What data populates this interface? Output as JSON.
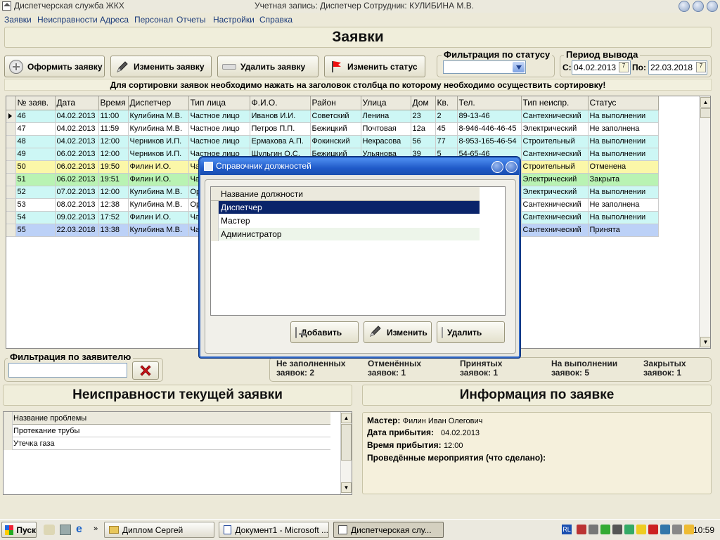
{
  "window": {
    "title": "Диспетчерская служба ЖКХ",
    "account": "Учетная запись:  Диспетчер   Сотрудник:  КУЛИБИНА М.В."
  },
  "menu": [
    "Заявки",
    "Неисправности",
    "Адреса",
    "Персонал",
    "Отчеты",
    "Настройки",
    "Справка"
  ],
  "page_title": "Заявки",
  "toolbar": {
    "create": "Оформить заявку",
    "edit": "Изменить заявку",
    "delete": "Удалить заявку",
    "status": "Изменить статус"
  },
  "status_filter": {
    "label": "Фильтрация по статусу",
    "value": ""
  },
  "period": {
    "label": "Период вывода",
    "from_label": "С:",
    "from": "04.02.2013",
    "to_label": "По:",
    "to": "22.03.2018"
  },
  "sort_note": "Для сортировки заявок необходимо нажать на заголовок столбца по которому необходимо осуществить сортировку!",
  "grid": {
    "columns": [
      "№ заяв.",
      "Дата",
      "Время",
      "Диспетчер",
      "Тип лица",
      "Ф.И.О.",
      "Район",
      "Улица",
      "Дом",
      "Кв.",
      "Тел.",
      "Тип неиспр.",
      "Статус"
    ],
    "rows": [
      {
        "cells": [
          "46",
          "04.02.2013",
          "11:00",
          "Кулибина М.В.",
          "Частное лицо",
          "Иванов И.И.",
          "Советский",
          "Ленина",
          "23",
          "2",
          "89-13-46",
          "Сантехнический",
          "На выполнении"
        ],
        "color": "#cdf7f5"
      },
      {
        "cells": [
          "47",
          "04.02.2013",
          "11:59",
          "Кулибина М.В.",
          "Частное лицо",
          "Петров П.П.",
          "Бежицкий",
          "Почтовая",
          "12а",
          "45",
          "8-946-446-46-45",
          "Электрический",
          "Не заполнена"
        ],
        "color": "#ffffff"
      },
      {
        "cells": [
          "48",
          "04.02.2013",
          "12:00",
          "Черников И.П.",
          "Частное лицо",
          "Ермакова А.П.",
          "Фокинский",
          "Некрасова",
          "56",
          "77",
          "8-953-165-46-54",
          "Строительный",
          "На выполнении"
        ],
        "color": "#cdf7f5"
      },
      {
        "cells": [
          "49",
          "06.02.2013",
          "12:00",
          "Черников И.П.",
          "Частное лицо",
          "Шульгин О.С.",
          "Бежицкий",
          "Ульянова",
          "39",
          "5",
          "54-65-46",
          "Сантехнический",
          "На выполнении"
        ],
        "color": "#cdf7f5"
      },
      {
        "cells": [
          "50",
          "06.02.2013",
          "19:50",
          "Филин И.О.",
          "Ча",
          "",
          "",
          "",
          "",
          "",
          "",
          "Строительный",
          "Отменена"
        ],
        "color": "#fbf7a8"
      },
      {
        "cells": [
          "51",
          "06.02.2013",
          "19:51",
          "Филин И.О.",
          "Ча",
          "",
          "",
          "",
          "",
          "",
          "",
          "Электрический",
          "Закрыта"
        ],
        "color": "#b9f3b3"
      },
      {
        "cells": [
          "52",
          "07.02.2013",
          "12:00",
          "Кулибина М.В.",
          "Ор",
          "",
          "",
          "",
          "",
          "",
          "",
          "Электрический",
          "На выполнении"
        ],
        "color": "#cdf7f5"
      },
      {
        "cells": [
          "53",
          "08.02.2013",
          "12:38",
          "Кулибина М.В.",
          "Ор",
          "",
          "",
          "",
          "",
          "",
          "",
          "Сантехнический",
          "Не заполнена"
        ],
        "color": "#ffffff"
      },
      {
        "cells": [
          "54",
          "09.02.2013",
          "17:52",
          "Филин И.О.",
          "Ча",
          "",
          "",
          "",
          "",
          "",
          "",
          "Сантехнический",
          "На выполнении"
        ],
        "color": "#cdf7f5"
      },
      {
        "cells": [
          "55",
          "22.03.2018",
          "13:38",
          "Кулибина М.В.",
          "Ча",
          "",
          "",
          "",
          "",
          "",
          "",
          "Сантехнический",
          "Принята"
        ],
        "color": "#bcd1f7"
      }
    ]
  },
  "applicant_filter": {
    "label": "Фильтрация по заявителю",
    "value": ""
  },
  "stats": [
    {
      "line1": "Не заполненных",
      "line2": "заявок: 2"
    },
    {
      "line1": "Отменённых",
      "line2": "заявок: 1"
    },
    {
      "line1": "Принятых",
      "line2": "заявок: 1"
    },
    {
      "line1": "На выполнении",
      "line2": "заявок: 5"
    },
    {
      "line1": "Закрытых",
      "line2": "заявок: 1"
    }
  ],
  "faults": {
    "title": "Неисправности текущей заявки",
    "header": "Название проблемы",
    "items": [
      "Протекание трубы",
      "Утечка газа"
    ]
  },
  "info": {
    "title": "Информация по заявке",
    "master_label": "Мастер:",
    "master": "Филин Иван Олегович",
    "arrival_date_label": "Дата прибытия:",
    "arrival_date": "04.02.2013",
    "arrival_time_label": "Время прибытия:",
    "arrival_time": "12:00",
    "actions_label": "Проведённые мероприятия (что сделано):"
  },
  "dialog": {
    "title": "Справочник должностей",
    "header": "Название должности",
    "items": [
      "Диспетчер",
      "Мастер",
      "Администратор"
    ],
    "add": "Добавить",
    "edit": "Изменить",
    "delete": "Удалить"
  },
  "taskbar": {
    "start": "Пуск",
    "tasks": [
      "Диплом Сергей",
      "Документ1 - Microsoft ...",
      "Диспетчерская слу..."
    ],
    "lang": "RL",
    "clock": "10:59"
  }
}
